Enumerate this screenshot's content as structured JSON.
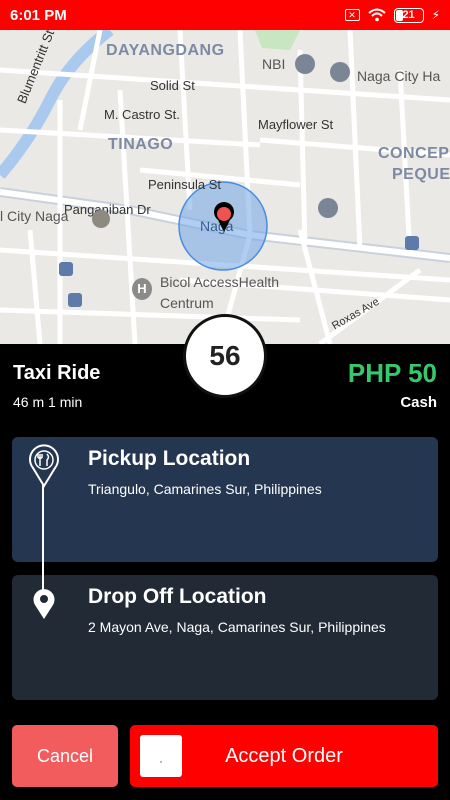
{
  "status_bar": {
    "time": "6:01 PM",
    "sim_text": "✕",
    "battery_level": "21"
  },
  "map": {
    "labels": {
      "dayangdang": "DAYANGDANG",
      "nbi": "NBI",
      "naga_city_hall": "Naga City Ha",
      "blumentritt": "Blumentritt St",
      "solid": "Solid St",
      "m_castro": "M. Castro St.",
      "mayflower": "Mayflower St",
      "tinago": "TINAGO",
      "concepcion": "CONCEPC",
      "pequena": "PEQUEÑ",
      "peninsula": "Peninsula St",
      "panganiban": "Panganiban Dr",
      "city_naga": "l City Naga",
      "naga": "Naga",
      "bicol_access": "Bicol AccessHealth",
      "centrum": "Centrum",
      "roxas": "Roxas Ave"
    }
  },
  "timer": {
    "value": "56"
  },
  "ride": {
    "title": "Taxi Ride",
    "meta": "46 m 1 min",
    "price": "PHP 50",
    "payment": "Cash"
  },
  "pickup": {
    "label": "Pickup Location",
    "address": "Triangulo, Camarines Sur, Philippines"
  },
  "dropoff": {
    "label": "Drop Off Location",
    "address": "2 Mayon Ave, Naga, Camarines Sur, Philippines"
  },
  "actions": {
    "cancel": "Cancel",
    "accept": "Accept Order"
  },
  "colors": {
    "accent": "#ff0000",
    "price": "#36c96b",
    "pickup_card": "#253650",
    "dropoff_card": "#222a35"
  }
}
